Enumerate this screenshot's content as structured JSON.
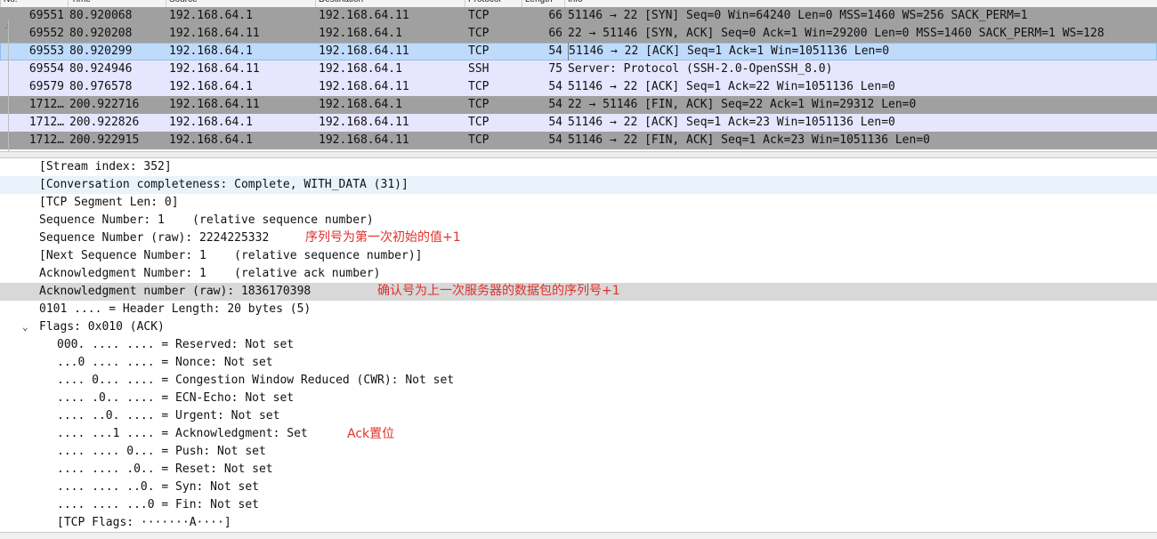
{
  "packet_list": {
    "columns": [
      "No.",
      "Time",
      "Source",
      "Destination",
      "Protocol",
      "Length",
      "Info"
    ],
    "rows": [
      {
        "no": "69551",
        "time": "80.920068",
        "src": "192.168.64.1",
        "dst": "192.168.64.11",
        "proto": "TCP",
        "len": "66",
        "info": "51146 → 22 [SYN] Seq=0 Win=64240 Len=0 MSS=1460 WS=256 SACK_PERM=1",
        "style": "dark"
      },
      {
        "no": "69552",
        "time": "80.920208",
        "src": "192.168.64.11",
        "dst": "192.168.64.1",
        "proto": "TCP",
        "len": "66",
        "info": "22 → 51146 [SYN, ACK] Seq=0 Ack=1 Win=29200 Len=0 MSS=1460 SACK_PERM=1 WS=128",
        "style": "dark"
      },
      {
        "no": "69553",
        "time": "80.920299",
        "src": "192.168.64.1",
        "dst": "192.168.64.11",
        "proto": "TCP",
        "len": "54",
        "info": "51146 → 22 [ACK] Seq=1 Ack=1 Win=1051136 Len=0",
        "style": "sel"
      },
      {
        "no": "69554",
        "time": "80.924946",
        "src": "192.168.64.11",
        "dst": "192.168.64.1",
        "proto": "SSH",
        "len": "75",
        "info": "Server: Protocol (SSH-2.0-OpenSSH_8.0)",
        "style": "light"
      },
      {
        "no": "69579",
        "time": "80.976578",
        "src": "192.168.64.1",
        "dst": "192.168.64.11",
        "proto": "TCP",
        "len": "54",
        "info": "51146 → 22 [ACK] Seq=1 Ack=22 Win=1051136 Len=0",
        "style": "light"
      },
      {
        "no": "1712…",
        "time": "200.922716",
        "src": "192.168.64.11",
        "dst": "192.168.64.1",
        "proto": "TCP",
        "len": "54",
        "info": "22 → 51146 [FIN, ACK] Seq=22 Ack=1 Win=29312 Len=0",
        "style": "dark"
      },
      {
        "no": "1712…",
        "time": "200.922826",
        "src": "192.168.64.1",
        "dst": "192.168.64.11",
        "proto": "TCP",
        "len": "54",
        "info": "51146 → 22 [ACK] Seq=1 Ack=23 Win=1051136 Len=0",
        "style": "light"
      },
      {
        "no": "1712…",
        "time": "200.922915",
        "src": "192.168.64.1",
        "dst": "192.168.64.11",
        "proto": "TCP",
        "len": "54",
        "info": "51146 → 22 [FIN, ACK] Seq=1 Ack=23 Win=1051136 Len=0",
        "style": "dark"
      }
    ]
  },
  "details": {
    "lines": [
      {
        "text": "[Stream index: 352]",
        "level": 1
      },
      {
        "text": "[Conversation completeness: Complete, WITH_DATA (31)]",
        "level": 1,
        "highlight": "blue"
      },
      {
        "text": "[TCP Segment Len: 0]",
        "level": 1
      },
      {
        "text": "Sequence Number: 1    (relative sequence number)",
        "level": 1
      },
      {
        "text": "Sequence Number (raw): 2224225332",
        "level": 1
      },
      {
        "text": "[Next Sequence Number: 1    (relative sequence number)]",
        "level": 1
      },
      {
        "text": "Acknowledgment Number: 1    (relative ack number)",
        "level": 1
      },
      {
        "text": "Acknowledgment number (raw): 1836170398",
        "level": 1,
        "highlight": "gray"
      },
      {
        "text": "0101 .... = Header Length: 20 bytes (5)",
        "level": 1
      },
      {
        "text": "Flags: 0x010 (ACK)",
        "level": 1,
        "expanded": true
      },
      {
        "text": "000. .... .... = Reserved: Not set",
        "level": 2
      },
      {
        "text": "...0 .... .... = Nonce: Not set",
        "level": 2
      },
      {
        "text": ".... 0... .... = Congestion Window Reduced (CWR): Not set",
        "level": 2
      },
      {
        "text": ".... .0.. .... = ECN-Echo: Not set",
        "level": 2
      },
      {
        "text": ".... ..0. .... = Urgent: Not set",
        "level": 2
      },
      {
        "text": ".... ...1 .... = Acknowledgment: Set",
        "level": 2
      },
      {
        "text": ".... .... 0... = Push: Not set",
        "level": 2
      },
      {
        "text": ".... .... .0.. = Reset: Not set",
        "level": 2
      },
      {
        "text": ".... .... ..0. = Syn: Not set",
        "level": 2
      },
      {
        "text": ".... .... ...0 = Fin: Not set",
        "level": 2
      },
      {
        "text": "[TCP Flags: ·······A····]",
        "level": 2
      }
    ],
    "expander_glyph": "⌄"
  },
  "annotations": {
    "seq_note": "序列号为第一次初始的值+1",
    "ack_note": "确认号为上一次服务器的数据包的序列号+1",
    "flag_note": "Ack置位"
  },
  "colors": {
    "dark_row": "#a0a0a0",
    "light_row": "#e7e6ff",
    "selected_row": "#bfdbfb",
    "annotation": "#e0312b"
  }
}
